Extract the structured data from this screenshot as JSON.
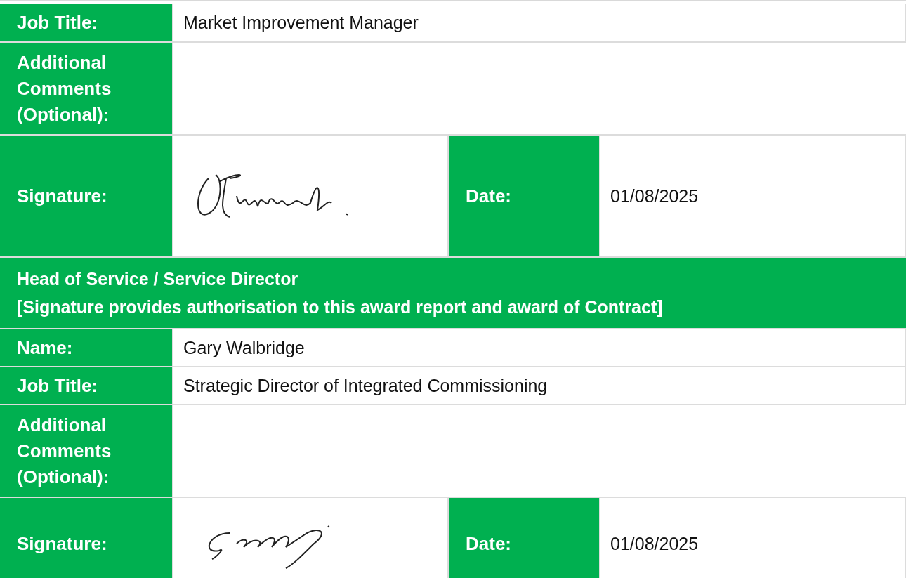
{
  "rows": [
    {
      "kind": "field",
      "label": "Job Title:",
      "value": "Market Improvement Manager"
    },
    {
      "kind": "comments",
      "label": "Additional Comments (Optional):"
    },
    {
      "kind": "signature",
      "label": "Signature:",
      "date_label": "Date:",
      "date": "01/08/2025"
    },
    {
      "kind": "heading",
      "lines": [
        "Head of Service / Service Director",
        "[Signature provides authorisation to this award report and award of Contract]"
      ]
    },
    {
      "kind": "field",
      "label": "Name:",
      "value": "Gary Walbridge"
    },
    {
      "kind": "field",
      "label": "Job Title:",
      "value": "Strategic Director of Integrated Commissioning"
    },
    {
      "kind": "comments",
      "label": "Additional Comments (Optional):"
    },
    {
      "kind": "signature",
      "label": "Signature:",
      "date_label": "Date:",
      "date": "01/08/2025"
    }
  ]
}
